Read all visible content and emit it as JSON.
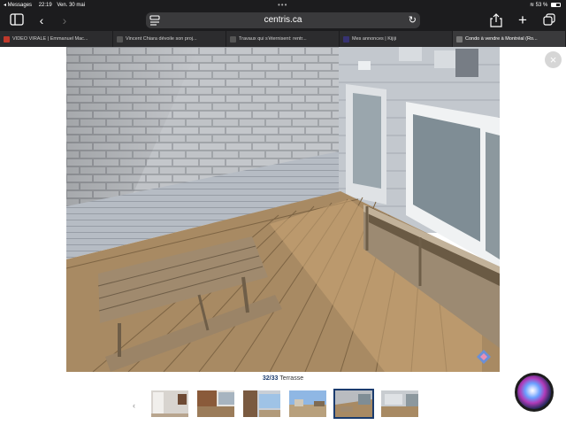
{
  "status_bar": {
    "back_app": "◂ Messages",
    "time": "22:19",
    "date": "Ven. 30 mai",
    "center_dots": "•••",
    "battery": "53 %"
  },
  "toolbar": {
    "url": "centris.ca"
  },
  "tabs": [
    {
      "label": "VIDEO VIRALE | Emmanuel Mac...",
      "favicon_color": "#c0392b",
      "active": false
    },
    {
      "label": "Vincent Chiara dévoile son proj...",
      "favicon_color": "#555555",
      "active": false
    },
    {
      "label": "Travaux qui s'éternisent: rentr...",
      "favicon_color": "#555555",
      "active": false
    },
    {
      "label": "Mes annonces | Kijiji",
      "favicon_color": "#373373",
      "active": false
    },
    {
      "label": "Condo à vendre à Montréal (Ro...",
      "favicon_color": "#777777",
      "active": true
    }
  ],
  "gallery": {
    "counter": "32/33",
    "caption": "Terrasse",
    "thumbnail_count": 6,
    "selected_thumbnail": 5
  },
  "colors": {
    "accent": "#1a3b6e",
    "chrome": "#1c1c1e"
  }
}
